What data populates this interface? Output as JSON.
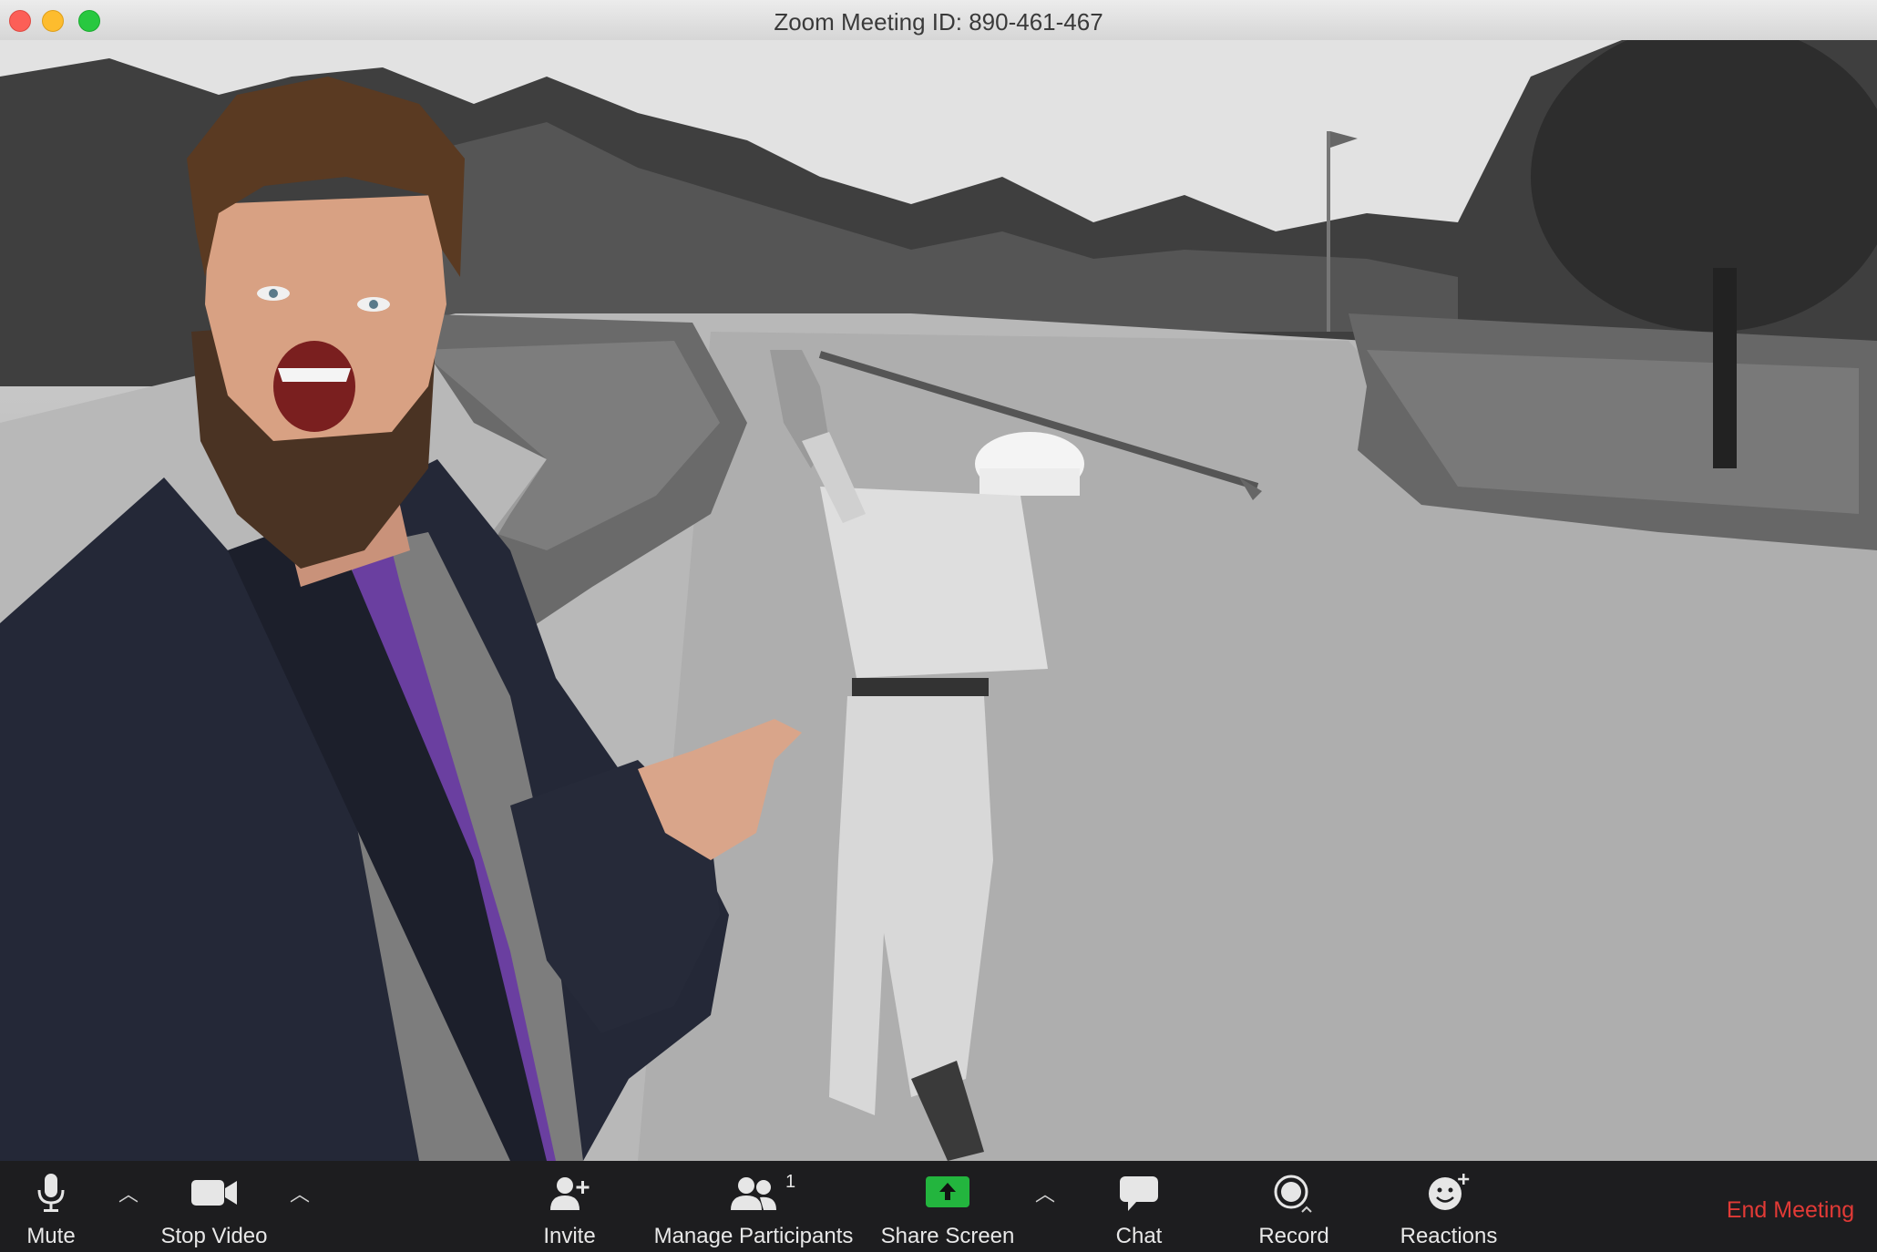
{
  "window": {
    "title": "Zoom Meeting ID: 890-461-467"
  },
  "toolbar": {
    "mute_label": "Mute",
    "stop_video_label": "Stop Video",
    "invite_label": "Invite",
    "manage_participants_label": "Manage Participants",
    "participant_count": "1",
    "share_screen_label": "Share Screen",
    "chat_label": "Chat",
    "record_label": "Record",
    "reactions_label": "Reactions",
    "end_meeting_label": "End Meeting"
  },
  "icons": [
    "microphone-icon",
    "chevron-up-icon",
    "video-camera-icon",
    "add-person-icon",
    "participants-icon",
    "share-screen-icon",
    "chat-bubble-icon",
    "record-icon",
    "reactions-icon"
  ],
  "colors": {
    "end_meeting": "#e23a36",
    "share_screen": "#23b53e",
    "toolbar_bg": "#1d1d1f"
  }
}
